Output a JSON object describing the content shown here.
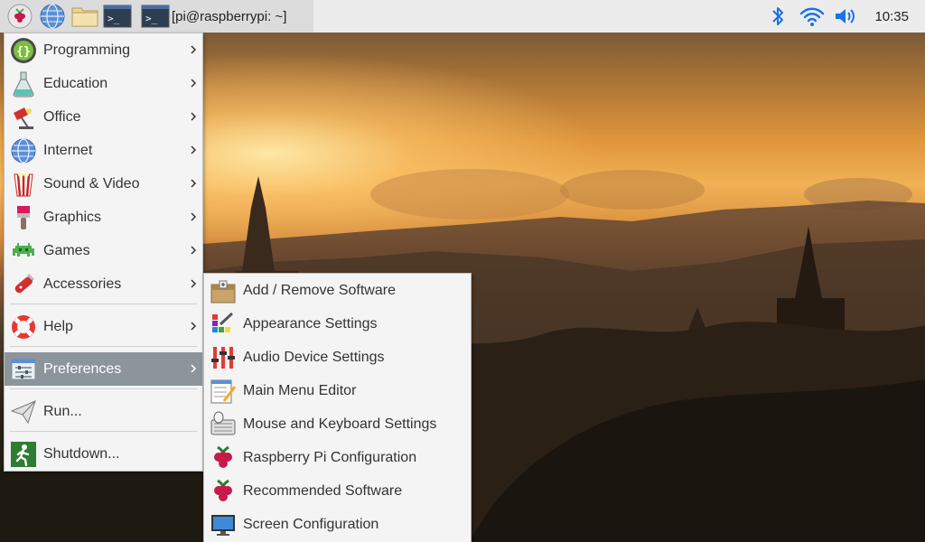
{
  "taskbar": {
    "task_title": "[pi@raspberrypi: ~]",
    "clock": "10:35",
    "launchers": [
      "raspberry-menu-icon",
      "web-browser-icon",
      "file-manager-icon",
      "terminal-icon"
    ],
    "tray": [
      "bluetooth-icon",
      "wifi-icon",
      "volume-icon"
    ]
  },
  "main_menu": {
    "items": [
      {
        "label": "Programming",
        "icon": "programming-icon",
        "has_submenu": true
      },
      {
        "label": "Education",
        "icon": "education-icon",
        "has_submenu": true
      },
      {
        "label": "Office",
        "icon": "office-icon",
        "has_submenu": true
      },
      {
        "label": "Internet",
        "icon": "internet-icon",
        "has_submenu": true
      },
      {
        "label": "Sound & Video",
        "icon": "sound-video-icon",
        "has_submenu": true
      },
      {
        "label": "Graphics",
        "icon": "graphics-icon",
        "has_submenu": true
      },
      {
        "label": "Games",
        "icon": "games-icon",
        "has_submenu": true
      },
      {
        "label": "Accessories",
        "icon": "accessories-icon",
        "has_submenu": true
      },
      {
        "label": "Help",
        "icon": "help-icon",
        "has_submenu": true
      },
      {
        "label": "Preferences",
        "icon": "preferences-icon",
        "has_submenu": true,
        "active": true
      },
      {
        "label": "Run...",
        "icon": "run-icon",
        "has_submenu": false
      },
      {
        "label": "Shutdown...",
        "icon": "shutdown-icon",
        "has_submenu": false
      }
    ]
  },
  "preferences_menu": {
    "items": [
      {
        "label": "Add / Remove Software",
        "icon": "software-package-icon"
      },
      {
        "label": "Appearance Settings",
        "icon": "appearance-icon"
      },
      {
        "label": "Audio Device Settings",
        "icon": "audio-mixer-icon"
      },
      {
        "label": "Main Menu Editor",
        "icon": "menu-editor-icon"
      },
      {
        "label": "Mouse and Keyboard Settings",
        "icon": "keyboard-mouse-icon"
      },
      {
        "label": "Raspberry Pi Configuration",
        "icon": "raspberry-pi-icon"
      },
      {
        "label": "Recommended Software",
        "icon": "raspberry-pi-icon"
      },
      {
        "label": "Screen Configuration",
        "icon": "monitor-icon"
      }
    ]
  },
  "colors": {
    "taskbar_bg": "#ececec",
    "menu_bg": "#f4f4f4",
    "highlight": "#8d959c",
    "tray_blue": "#1a73e8"
  }
}
